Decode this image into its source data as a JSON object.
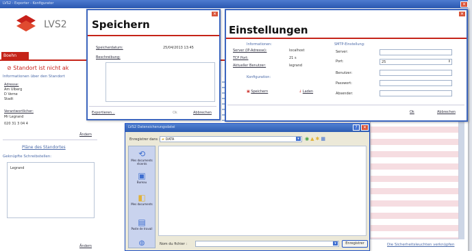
{
  "main": {
    "title": "LVS2 - Exporter - Konfigurator",
    "logo_text": "LVS2",
    "tab": "Boehn",
    "status_heading": "Standort ist nicht ak",
    "info_heading": "Informationen über den Standort",
    "address_label": "Adresse:",
    "address_lines": [
      "Am Ulberg",
      "D Verne",
      "Stadt"
    ],
    "responsible_label": "Verantwortlicher:",
    "responsible_name": "Mr Legrand",
    "phone": "020 31 3 04 4",
    "change_link_1": "Ändern",
    "plan_link": "Pläne des Standortes",
    "schedule_label": "Geknüpfte Schreibstellen:",
    "schedule_value": "Legrand",
    "change_link_2": "Ändern",
    "footer_link": "Die Sicherheitsleuchten verknüpfen"
  },
  "speichern": {
    "title": "Speichern",
    "date_label": "Speicherdatum:",
    "date_value": "25/04/2013 13:45",
    "desc_label": "Beschreibung:",
    "export_link": "Exportieren...",
    "ok": "Ok",
    "cancel": "Abbrechen"
  },
  "einstellungen": {
    "title": "Einstellungen",
    "info_group": "Informationen:",
    "server_label": "Server (IP-Adresse):",
    "server_value": "localhost",
    "port_label": "TCP Port:",
    "port_value": "21 s",
    "user_label": "Aktueller Benutzer:",
    "user_value": "legrand",
    "config_group": "Konfiguration:",
    "save_btn": "Speichern",
    "load_btn": "Laden",
    "smtp_group": "SMTP-Einstellung:",
    "smtp_server_label": "Server:",
    "smtp_port_label": "Port:",
    "smtp_port_value": "25",
    "smtp_user_label": "Benutzer:",
    "smtp_pass_label": "Passwort:",
    "smtp_from_label": "Absender:",
    "ok": "Ok",
    "cancel": "Abbrechen"
  },
  "save_dialog": {
    "title": "LVS2 Datensicherungsdatei",
    "save_in_label": "Enregistrer dans :",
    "save_in_value": "DATA",
    "places": [
      "Mes documents récents",
      "Bureau",
      "Mes documents",
      "Poste de travail"
    ],
    "filename_label": "Nom du fichier :",
    "filename_value": "",
    "save_button": "Enregistrer"
  }
}
